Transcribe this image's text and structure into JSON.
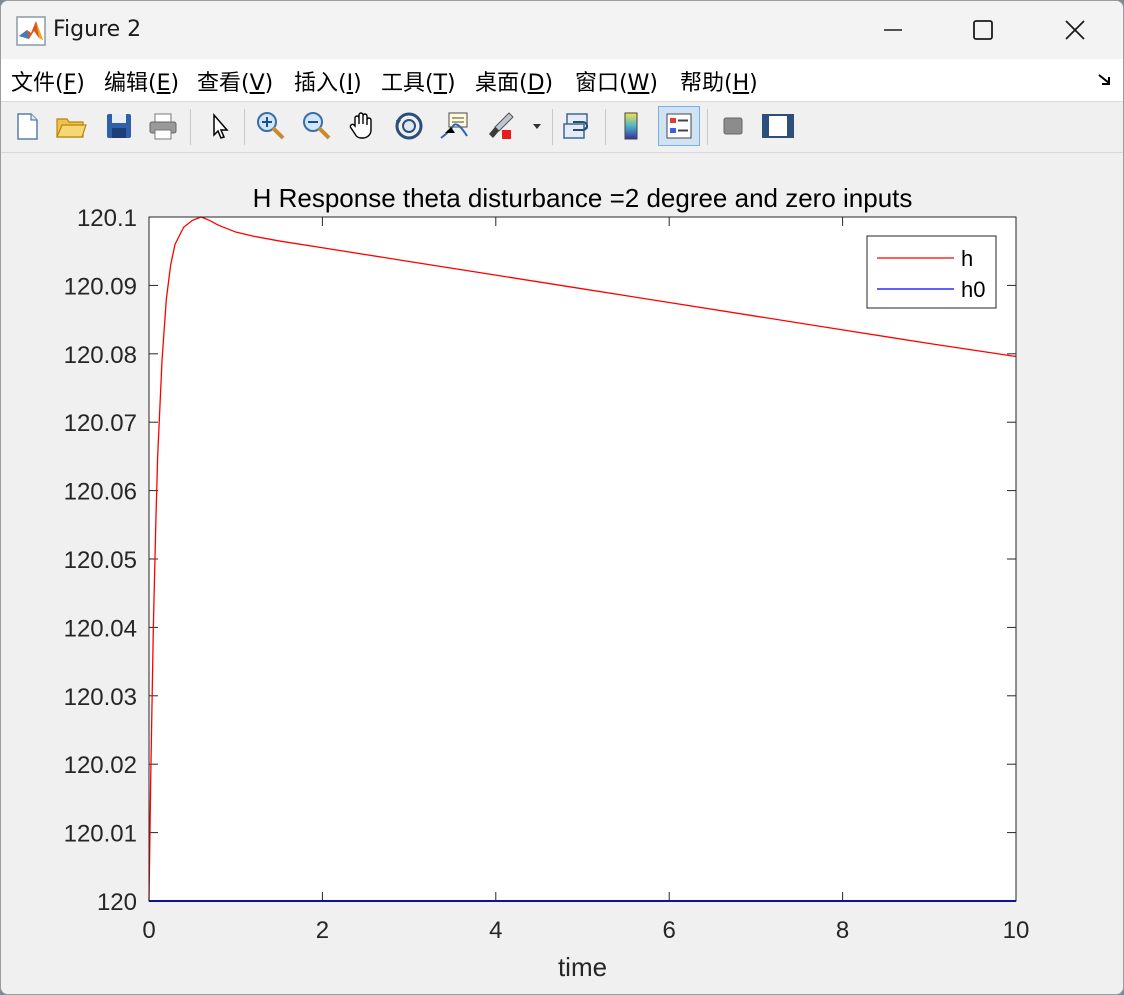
{
  "window": {
    "title": "Figure 2"
  },
  "menubar": {
    "items": [
      {
        "label": "文件(",
        "key": "F",
        "end": ")"
      },
      {
        "label": "编辑(",
        "key": "E",
        "end": ")"
      },
      {
        "label": "查看(",
        "key": "V",
        "end": ")"
      },
      {
        "label": "插入(",
        "key": "I",
        "end": ")"
      },
      {
        "label": "工具(",
        "key": "T",
        "end": ")"
      },
      {
        "label": "桌面(",
        "key": "D",
        "end": ")"
      },
      {
        "label": "窗口(",
        "key": "W",
        "end": ")"
      },
      {
        "label": "帮助(",
        "key": "H",
        "end": ")"
      }
    ]
  },
  "toolbar": {
    "icons": [
      "new-file-icon",
      "open-folder-icon",
      "save-icon",
      "print-icon",
      "pointer-icon",
      "zoom-in-icon",
      "zoom-out-icon",
      "pan-hand-icon",
      "rotate-3d-icon",
      "data-cursor-icon",
      "brush-icon",
      "link-plot-icon",
      "colorbar-icon",
      "legend-icon",
      "hide-plot-tools-icon",
      "show-plot-tools-icon"
    ]
  },
  "colors": {
    "h": "#ff0000",
    "h0": "#0000ff",
    "axes_bg": "#ffffff",
    "figure_bg": "#f0f0f0"
  },
  "chart_data": {
    "type": "line",
    "title": "H Response theta disturbance =2 degree and zero inputs",
    "xlabel": "time",
    "ylabel": "",
    "xlim": [
      0,
      10
    ],
    "ylim": [
      120,
      120.1
    ],
    "xticks": [
      "0",
      "2",
      "4",
      "6",
      "8",
      "10"
    ],
    "yticks": [
      "120",
      "120.01",
      "120.02",
      "120.03",
      "120.04",
      "120.05",
      "120.06",
      "120.07",
      "120.08",
      "120.09",
      "120.1"
    ],
    "grid": false,
    "legend_position": "top-right",
    "series": [
      {
        "name": "h",
        "color": "#ff0000",
        "x": [
          0,
          0.02,
          0.05,
          0.08,
          0.1,
          0.15,
          0.2,
          0.25,
          0.3,
          0.4,
          0.5,
          0.6,
          0.7,
          0.8,
          1.0,
          1.2,
          1.5,
          2.0,
          3.0,
          4.0,
          5.0,
          6.0,
          7.0,
          8.0,
          9.0,
          10.0
        ],
        "y": [
          120.0,
          120.018,
          120.04,
          120.056,
          120.065,
          120.079,
          120.088,
          120.093,
          120.096,
          120.0985,
          120.0995,
          120.1,
          120.0995,
          120.0988,
          120.0978,
          120.0972,
          120.0965,
          120.0955,
          120.0935,
          120.0915,
          120.0895,
          120.0875,
          120.0855,
          120.0835,
          120.0815,
          120.0796
        ]
      },
      {
        "name": "h0",
        "color": "#0000ff",
        "x": [
          0,
          10
        ],
        "y": [
          120.0,
          120.0
        ]
      }
    ]
  }
}
